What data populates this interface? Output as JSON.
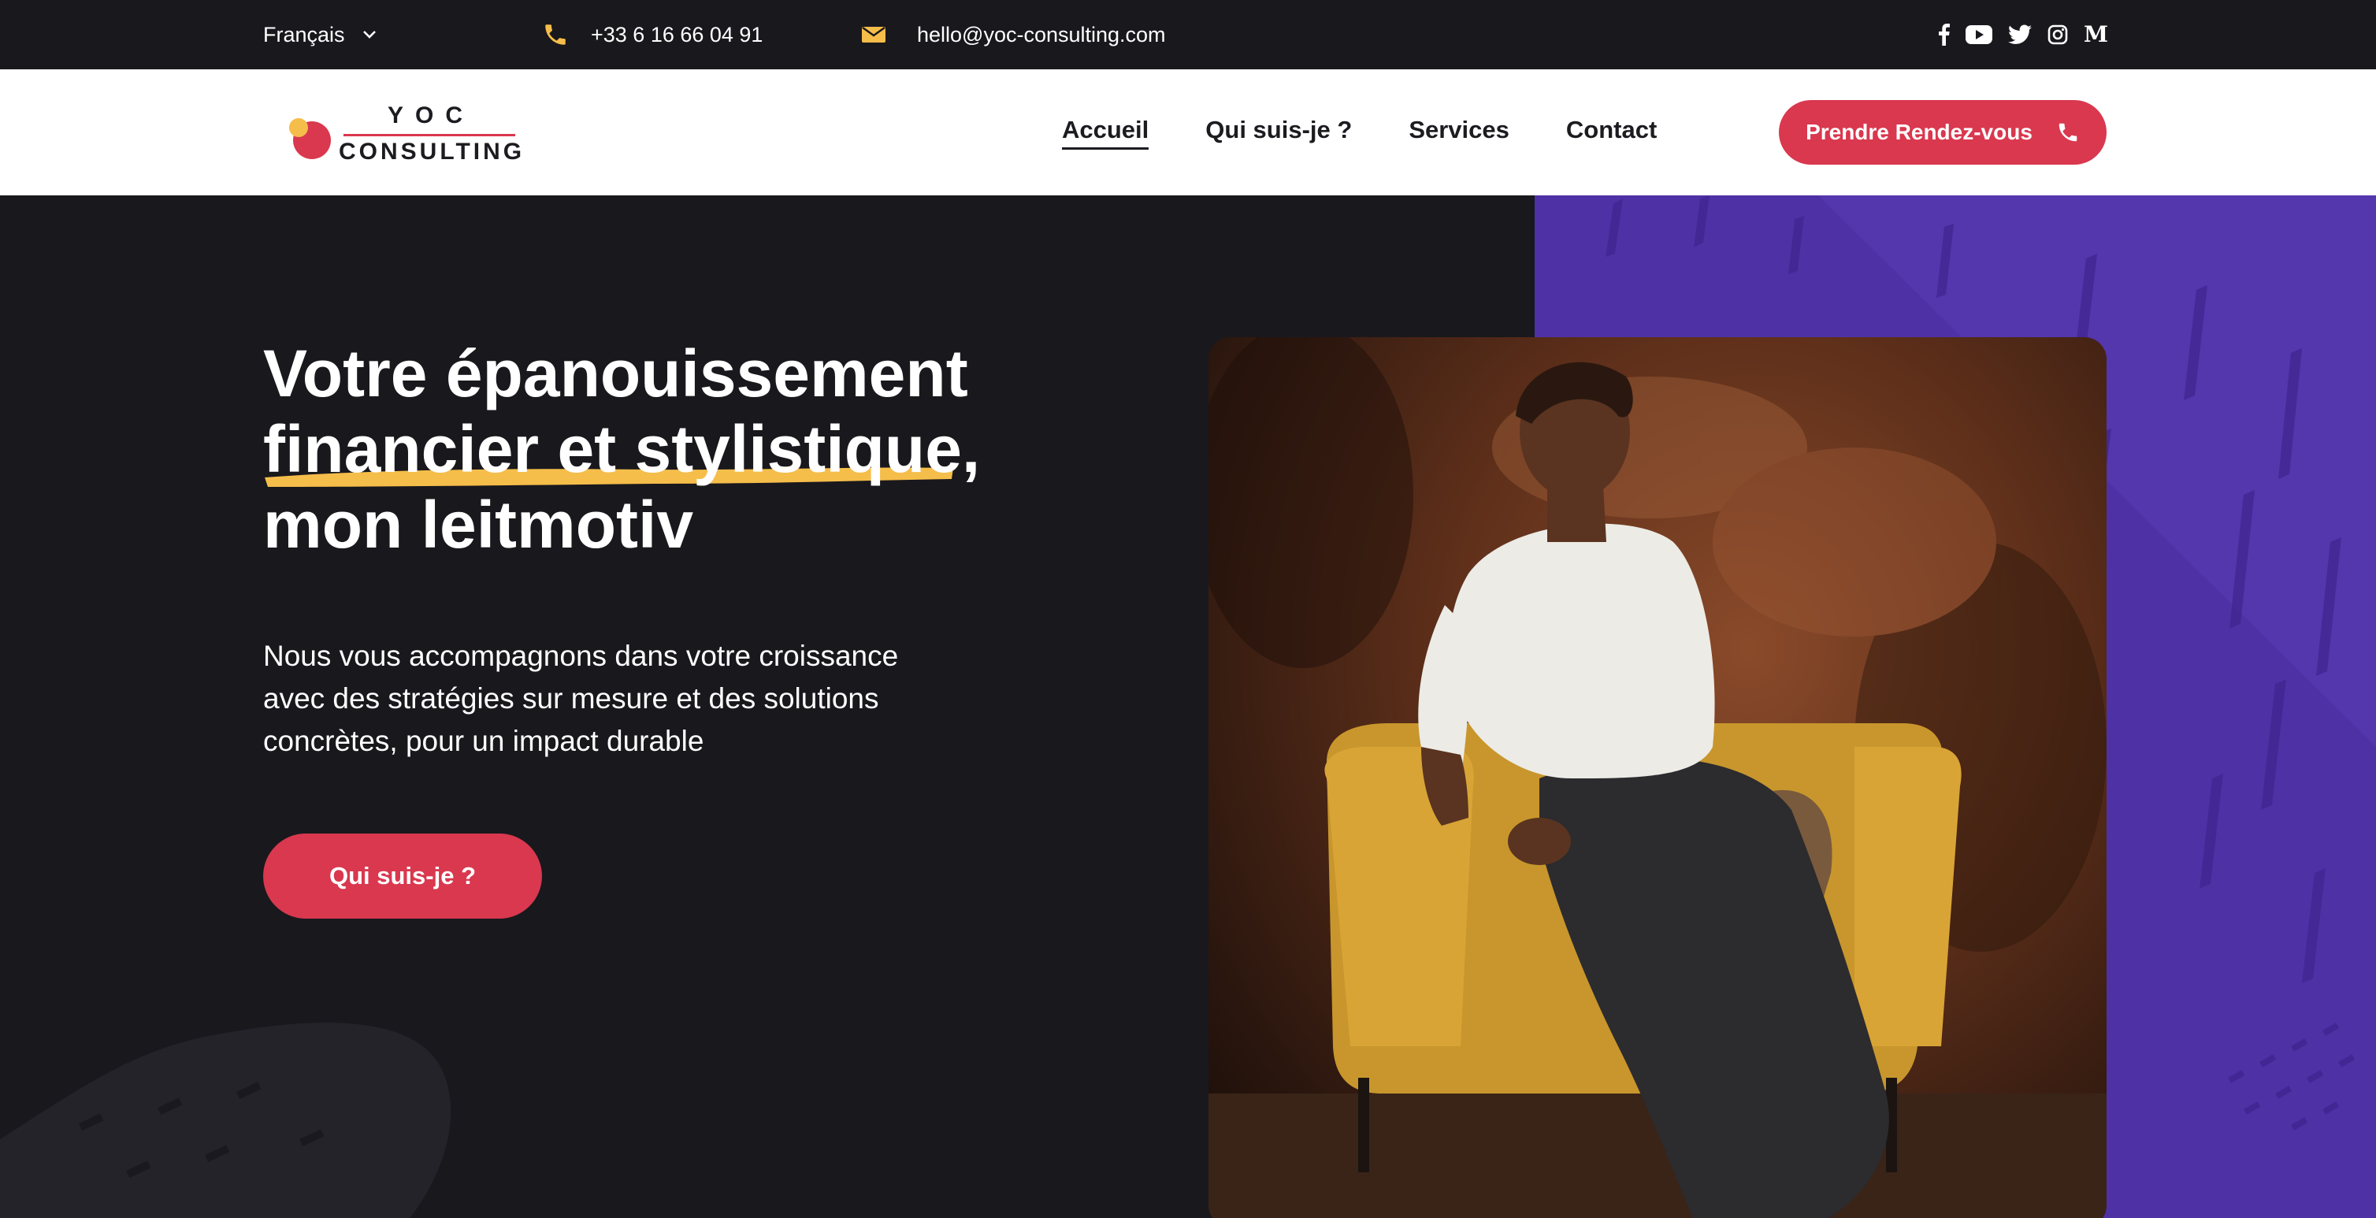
{
  "topbar": {
    "language": "Français",
    "phone": "+33 6 16 66 04 91",
    "email": "hello@yoc-consulting.com",
    "social": [
      "facebook-icon",
      "youtube-icon",
      "twitter-icon",
      "instagram-icon",
      "medium-icon"
    ],
    "medium_glyph": "M"
  },
  "header": {
    "logo_top": "YOC",
    "logo_bottom": "CONSULTING",
    "nav": [
      "Accueil",
      "Qui suis-je ?",
      "Services",
      "Contact"
    ],
    "active_nav": "Accueil",
    "cta": "Prendre Rendez-vous"
  },
  "hero": {
    "headline_line1": "Votre épanouissement",
    "headline_highlight": "financier et stylistique",
    "headline_comma": ",",
    "headline_line3": "mon leitmotiv",
    "lead_line1": "Nous vous accompagnons dans votre croissance",
    "lead_line2": "avec des stratégies sur mesure et des solutions",
    "lead_line3": "concrètes, pour un impact durable",
    "cta": "Qui suis-je ?"
  },
  "colors": {
    "dark": "#19181d",
    "accent_red": "#d9384f",
    "accent_yellow": "#f5bd4a",
    "purple": "#4f31a6",
    "white": "#ffffff"
  }
}
